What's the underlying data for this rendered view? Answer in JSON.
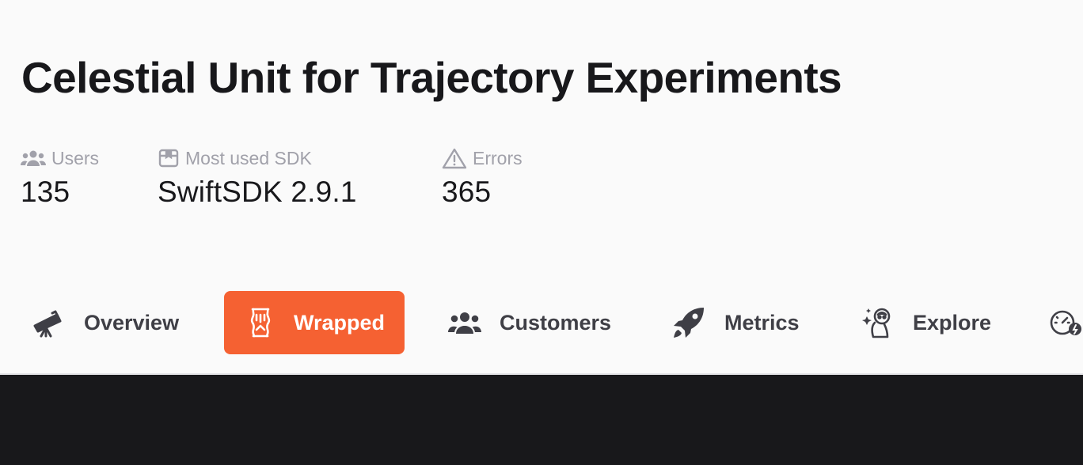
{
  "project": {
    "title": "Celestial Unit for Trajectory Experiments"
  },
  "stats": [
    {
      "icon": "users-icon",
      "label": "Users",
      "value": "135"
    },
    {
      "icon": "package-icon",
      "label": "Most used SDK",
      "value": "SwiftSDK 2.9.1"
    },
    {
      "icon": "warning-icon",
      "label": "Errors",
      "value": "365"
    }
  ],
  "tabs": [
    {
      "icon": "telescope-icon",
      "label": "Overview",
      "active": false
    },
    {
      "icon": "wrapped-icon",
      "label": "Wrapped",
      "active": true
    },
    {
      "icon": "users-icon",
      "label": "Customers",
      "active": false
    },
    {
      "icon": "rocket-icon",
      "label": "Metrics",
      "active": false
    },
    {
      "icon": "explore-icon",
      "label": "Explore",
      "active": false
    },
    {
      "icon": "gauge-icon",
      "label": "",
      "active": false
    }
  ],
  "colors": {
    "accent": "#f56132",
    "background": "#fafafa",
    "dark_panel": "#18181b",
    "muted_text": "#a1a1aa",
    "tab_text": "#3f3f46"
  }
}
